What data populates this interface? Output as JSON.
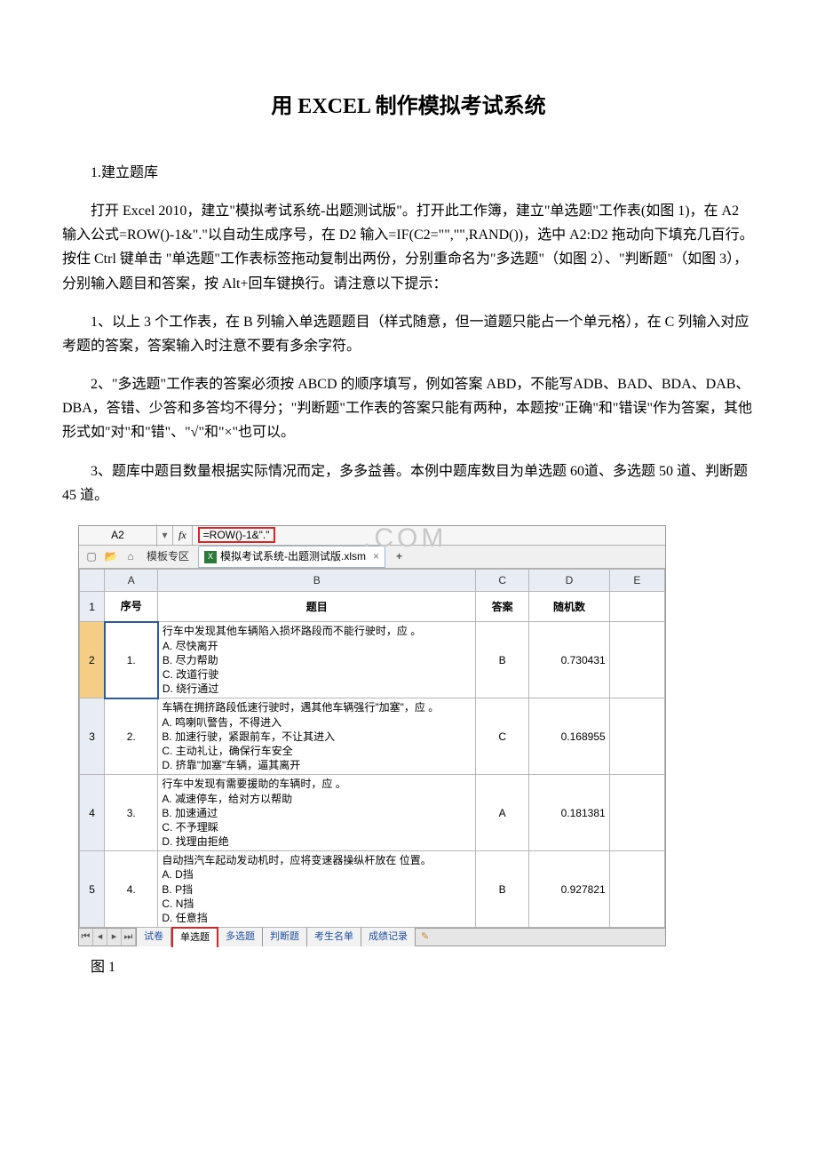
{
  "title": "用 EXCEL 制作模拟考试系统",
  "sections": {
    "h1": "1.建立题库",
    "p1": "打开 Excel 2010，建立\"模拟考试系统-出题测试版\"。打开此工作簿，建立\"单选题\"工作表(如图 1)，在 A2 输入公式=ROW()-1&\".\"以自动生成序号，在 D2 输入=IF(C2=\"\",\"\",RAND())，选中 A2:D2 拖动向下填充几百行。按住 Ctrl 键单击 \"单选题\"工作表标签拖动复制出两份，分别重命名为\"多选题\"（如图 2）、\"判断题\"（如图 3），分别输入题目和答案，按 Alt+回车键换行。请注意以下提示：",
    "p2": "1、以上 3 个工作表，在 B 列输入单选题题目（样式随意，但一道题只能占一个单元格），在 C 列输入对应考题的答案，答案输入时注意不要有多余字符。",
    "p3": "2、\"多选题\"工作表的答案必须按 ABCD 的顺序填写，例如答案 ABD，不能写ADB、BAD、BDA、DAB、DBA，答错、少答和多答均不得分；\"判断题\"工作表的答案只能有两种，本题按\"正确\"和\"错误\"作为答案，其他形式如\"对\"和\"错\"、\"√\"和\"×\"也可以。",
    "p4": "3、题库中题目数量根据实际情况而定，多多益善。本例中题库数目为单选题 60道、多选题 50 道、判断题 45 道。",
    "figcap1": "图 1"
  },
  "excel": {
    "watermark": ".COM",
    "namebox": "A2",
    "fx": "=ROW()-1&\".\"",
    "template_label": "模板专区",
    "file_tab": "模拟考试系统-出题测试版.xlsm",
    "cols": {
      "A": "A",
      "B": "B",
      "C": "C",
      "D": "D",
      "E": "E"
    },
    "header": {
      "num": "序号",
      "ques": "题目",
      "ans": "答案",
      "rand": "随机数"
    },
    "rows": [
      {
        "rownum": "2",
        "num": "1.",
        "ques": "行车中发现其他车辆陷入损坏路段而不能行驶时，应    。\nA. 尽快离开\nB. 尽力帮助\nC. 改道行驶\nD. 绕行通过",
        "ans": "B",
        "rand": "0.730431"
      },
      {
        "rownum": "3",
        "num": "2.",
        "ques": "车辆在拥挤路段低速行驶时，遇其他车辆强行\"加塞\"，应    。\nA. 鸣喇叭警告，不得进入\nB. 加速行驶，紧跟前车，不让其进入\nC. 主动礼让，确保行车安全\nD. 挤靠\"加塞\"车辆，逼其离开",
        "ans": "C",
        "rand": "0.168955"
      },
      {
        "rownum": "4",
        "num": "3.",
        "ques": "行车中发现有需要援助的车辆时，应    。\nA. 减速停车，给对方以帮助\nB. 加速通过\nC. 不予理睬\nD. 找理由拒绝",
        "ans": "A",
        "rand": "0.181381"
      },
      {
        "rownum": "5",
        "num": "4.",
        "ques": "自动挡汽车起动发动机时，应将变速器操纵杆放在    位置。\nA. D挡\nB. P挡\nC. N挡\nD. 任意挡",
        "ans": "B",
        "rand": "0.927821"
      }
    ],
    "sheets": [
      "试卷",
      "单选题",
      "多选题",
      "判断题",
      "考生名单",
      "成绩记录"
    ],
    "active_sheet": "单选题"
  }
}
